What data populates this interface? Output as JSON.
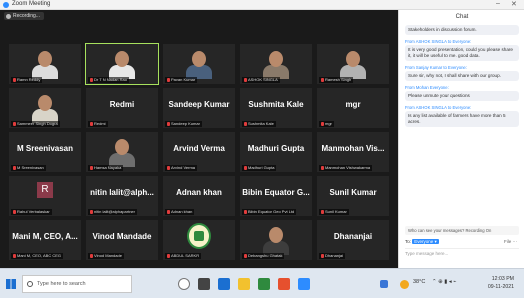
{
  "window": {
    "title": "Zoom Meeting",
    "controls": [
      "–",
      "✕"
    ]
  },
  "video": {
    "view_label": "Recording...",
    "tiles": [
      {
        "name_big": "",
        "label": "Ramn Reddy",
        "kind": "photo",
        "shirt": "#dcdcdc",
        "active": false
      },
      {
        "name_big": "",
        "label": "Dr T N Nadan Rao",
        "kind": "photo",
        "shirt": "#e8e8e8",
        "active": true
      },
      {
        "name_big": "",
        "label": "Pavan Kumar",
        "kind": "photo",
        "shirt": "#49607d",
        "active": false
      },
      {
        "name_big": "",
        "label": "ASHOK SINGLA",
        "kind": "photo",
        "shirt": "#8a7a6a",
        "active": false
      },
      {
        "name_big": "",
        "label": "Ramesh Singh",
        "kind": "photo",
        "shirt": "#b2b2b2",
        "active": false
      },
      {
        "name_big": "",
        "label": "Sammeer Singh Dogra",
        "kind": "photo",
        "shirt": "#d8d4c8",
        "active": false
      },
      {
        "name_big": "Redmi",
        "label": "Redmi",
        "kind": "name",
        "active": false
      },
      {
        "name_big": "Sandeep Kumar",
        "label": "Sandeep Kumar",
        "kind": "name",
        "active": false
      },
      {
        "name_big": "Sushmita Kale",
        "label": "Sushmita Kale",
        "kind": "name",
        "active": false
      },
      {
        "name_big": "mgr",
        "label": "mgr",
        "kind": "name",
        "active": false
      },
      {
        "name_big": "M Sreenivasan",
        "label": "M Sreenivasan",
        "kind": "name",
        "active": false
      },
      {
        "name_big": "",
        "label": "Hamsa Nayaka",
        "kind": "photo",
        "shirt": "#6e6e6e",
        "active": false
      },
      {
        "name_big": "Arvind Verma",
        "label": "Arvind Verma",
        "kind": "name",
        "active": false
      },
      {
        "name_big": "Madhuri Gupta",
        "label": "Madhuri Gupta",
        "kind": "name",
        "active": false
      },
      {
        "name_big": "Manmohan Vis...",
        "label": "Manmohan Vishwakarma",
        "kind": "name",
        "active": false
      },
      {
        "name_big": "",
        "label": "Rahul Verbalaskar",
        "kind": "avatar",
        "avatar": "R",
        "active": false
      },
      {
        "name_big": "nitin lalit@alph...",
        "label": "nitin lalit@alphapartner",
        "kind": "name",
        "active": false
      },
      {
        "name_big": "Adnan khan",
        "label": "Adnan khan",
        "kind": "name",
        "active": false
      },
      {
        "name_big": "Bibin Equator G...",
        "label": "Bibin Equator Geo Pvt Ltd",
        "kind": "name",
        "active": false
      },
      {
        "name_big": "Sunil Kumar",
        "label": "Sunil Kumar",
        "kind": "name",
        "active": false
      },
      {
        "name_big": "Mani M, CEO, A...",
        "label": "Mani M, CEO, ABC CEG",
        "kind": "name",
        "active": false
      },
      {
        "name_big": "Vinod Mandade",
        "label": "Vinod Mandade",
        "kind": "name",
        "active": false
      },
      {
        "name_big": "",
        "label": "ABDUL SARKR",
        "kind": "logo",
        "active": false
      },
      {
        "name_big": "",
        "label": "Debangshu Ghatak",
        "kind": "photo",
        "shirt": "#3d3d3d",
        "active": false
      },
      {
        "name_big": "Dhananjai",
        "label": "Dhananjai",
        "kind": "name",
        "active": false
      }
    ]
  },
  "chat": {
    "header": "Chat",
    "messages": [
      {
        "from": "",
        "text": "Stakeholders in discussion forum."
      },
      {
        "from": "From ASHOK SINGLA to Everyone:",
        "text": "It is very good presentation, could you please share it, it will be useful to me. good data."
      },
      {
        "from": "From Sanjay Kumar to Everyone:",
        "text": "Sure sir, why not, I shall share with our group."
      },
      {
        "from": "From Mohan Everyone:",
        "text": "Please unmute your questions"
      },
      {
        "from": "From ASHOK SINGLA to Everyone:",
        "text": "Is any list available of farmers have more than 5 acres."
      }
    ],
    "tip": "Who can see your messages? Recording On",
    "to_label": "To:",
    "to_value": "Everyone ▾",
    "more": "File ⋯",
    "input_placeholder": "Type message here..."
  },
  "taskbar": {
    "search_placeholder": "Type here to search",
    "tray_temp": "38°C",
    "time": "12:03 PM",
    "date": "09-11-2021"
  }
}
